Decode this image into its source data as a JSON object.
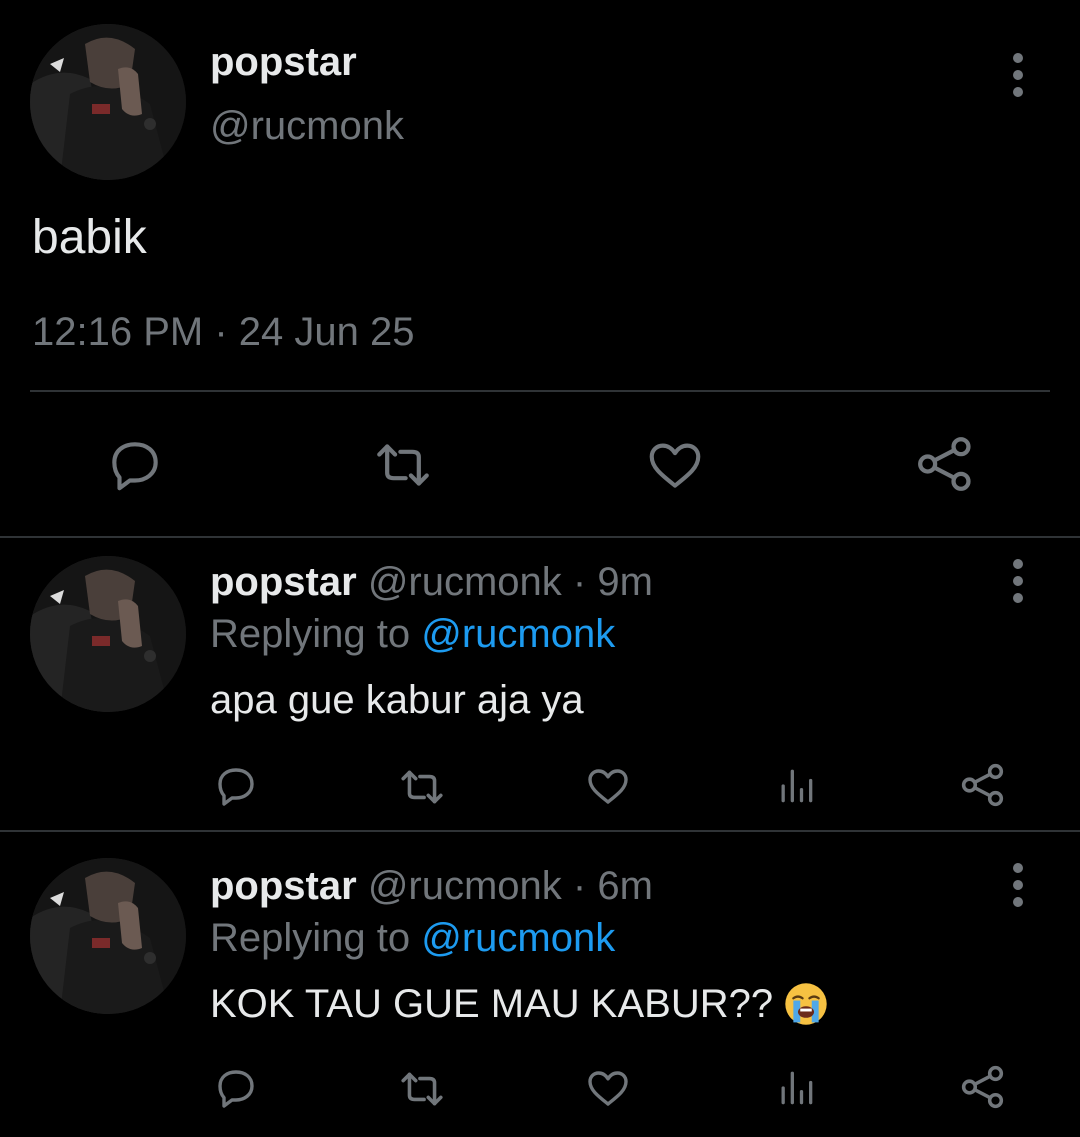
{
  "colors": {
    "background": "#000000",
    "primary_text": "#e7e9ea",
    "secondary_text": "#71767b",
    "link": "#1d9bf0",
    "divider": "#2f3336"
  },
  "main_tweet": {
    "display_name": "popstar",
    "handle": "@rucmonk",
    "text": "babik",
    "timestamp": "12:16 PM · 24 Jun 25",
    "icons": [
      "more-icon",
      "reply-icon",
      "retweet-icon",
      "like-icon",
      "share-icon"
    ]
  },
  "replies": [
    {
      "display_name": "popstar",
      "meta": "@rucmonk · 9m",
      "replying_prefix": "Replying to",
      "replying_to": "@rucmonk",
      "text": "apa gue kabur aja ya",
      "icons": [
        "reply-icon",
        "retweet-icon",
        "like-icon",
        "views-icon",
        "share-icon"
      ]
    },
    {
      "display_name": "popstar",
      "meta": "@rucmonk · 6m",
      "replying_prefix": "Replying to",
      "replying_to": "@rucmonk",
      "text": "KOK TAU GUE MAU KABUR??",
      "emoji": "loudly-crying-face-icon",
      "icons": [
        "reply-icon",
        "retweet-icon",
        "like-icon",
        "views-icon",
        "share-icon"
      ]
    }
  ]
}
